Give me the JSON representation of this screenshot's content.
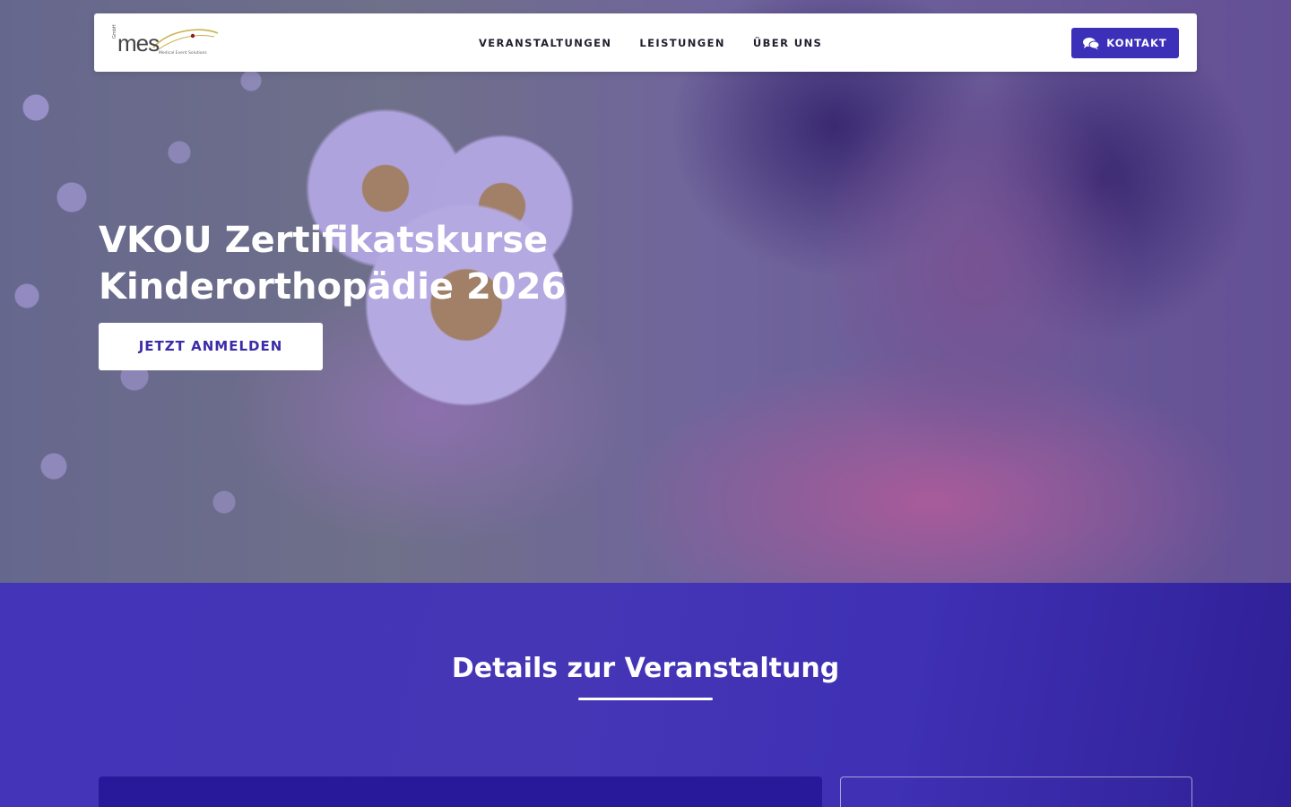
{
  "header": {
    "logo": {
      "text": "mes",
      "small_text": "GmbH",
      "subtitle": "Medical Event Solutions"
    },
    "nav": [
      {
        "label": "VERANSTALTUNGEN"
      },
      {
        "label": "LEISTUNGEN"
      },
      {
        "label": "ÜBER UNS"
      }
    ],
    "contact_button": {
      "label": "KONTAKT",
      "icon": "chat-bubbles-icon"
    }
  },
  "hero": {
    "title_line1": "VKOU Zertifikatskurse",
    "title_line2": "Kinderorthopädie 2026",
    "cta_label": "JETZT ANMELDEN"
  },
  "details": {
    "title": "Details zur Veranstaltung"
  },
  "colors": {
    "accent": "#3d30b8",
    "section_bg": "#4434b8",
    "card_dark": "#28189a",
    "text_dark": "#1f1f2e"
  }
}
